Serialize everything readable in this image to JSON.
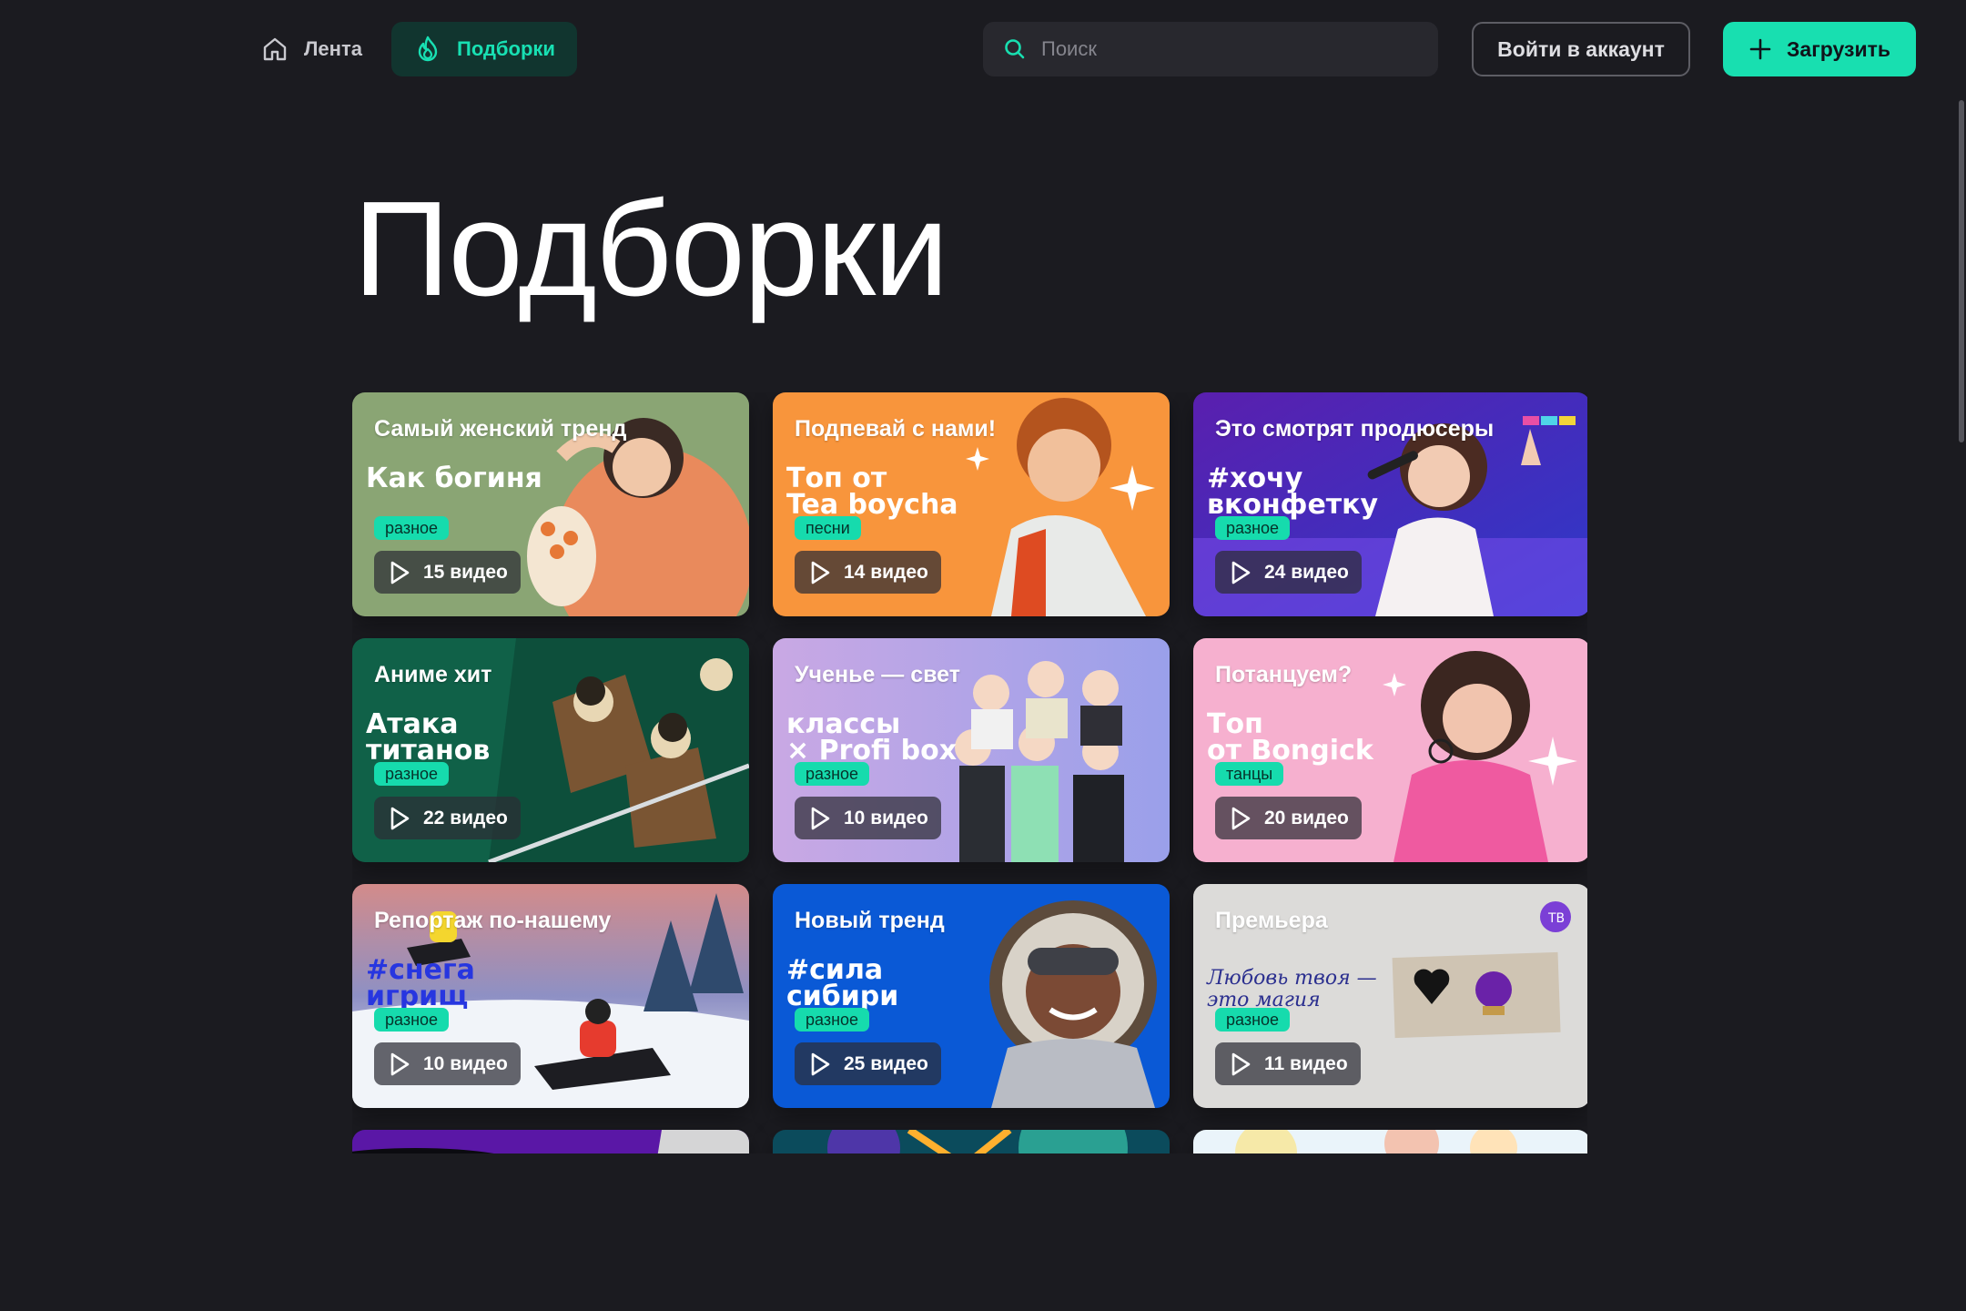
{
  "header": {
    "nav": [
      {
        "label": "Лента",
        "icon": "home-icon"
      },
      {
        "label": "Подборки",
        "icon": "fire-icon",
        "active": true
      }
    ],
    "search_placeholder": "Поиск",
    "login_label": "Войти в аккаунт",
    "upload_label": "Загрузить"
  },
  "page": {
    "title": "Подборки"
  },
  "colors": {
    "accent": "#18dfb0",
    "background": "#1b1b20"
  },
  "cards": [
    {
      "title": "Самый женский тренд",
      "subtitle": "Как богиня",
      "tag": "разное",
      "count": "15 видео",
      "theme": "sage"
    },
    {
      "title": "Подпевай с нами!",
      "subtitle": "Топ от\nTea boycha",
      "tag": "песни",
      "count": "14 видео",
      "theme": "orange"
    },
    {
      "title": "Это смотрят продюсеры",
      "subtitle": "#хочу\nвконфетку",
      "tag": "разное",
      "count": "24 видео",
      "theme": "violet"
    },
    {
      "title": "Аниме хит",
      "subtitle": "Атака\nтитанов",
      "tag": "разное",
      "count": "22 видео",
      "theme": "green"
    },
    {
      "title": "Ученье — свет",
      "subtitle": "классы\n× Profi box",
      "tag": "разное",
      "count": "10 видео",
      "theme": "lilac"
    },
    {
      "title": "Потанцуем?",
      "subtitle": "Топ\nот Bongick",
      "tag": "танцы",
      "count": "20 видео",
      "theme": "pink"
    },
    {
      "title": "Репортаж по-нашему",
      "subtitle": "#снега\nигрищ",
      "tag": "разное",
      "count": "10 видео",
      "theme": "snow"
    },
    {
      "title": "Новый тренд",
      "subtitle": "#сила\nсибири",
      "tag": "разное",
      "count": "25 видео",
      "theme": "blue"
    },
    {
      "title": "Премьера",
      "subtitle": "Любовь твоя —\nэто магия",
      "tag": "разное",
      "count": "11 видео",
      "theme": "paper"
    },
    {
      "title": "",
      "subtitle": "",
      "tag": "",
      "count": "",
      "theme": "purple-cut"
    },
    {
      "title": "",
      "subtitle": "",
      "tag": "",
      "count": "",
      "theme": "neon-cut"
    },
    {
      "title": "",
      "subtitle": "",
      "tag": "",
      "count": "",
      "theme": "pastel-cut"
    }
  ]
}
